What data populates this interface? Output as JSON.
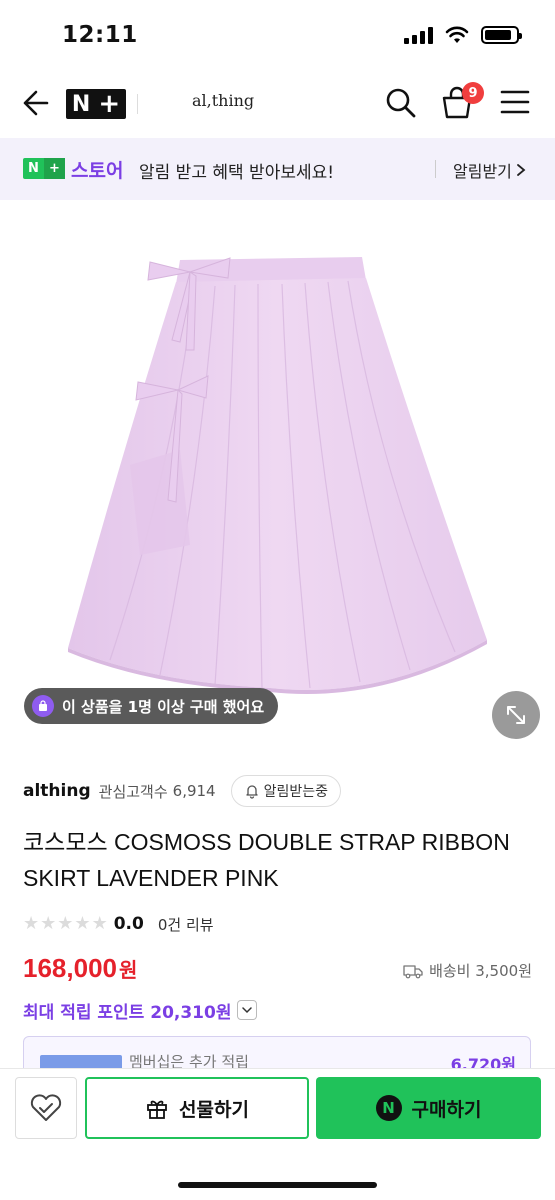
{
  "status_bar": {
    "time": "12:11",
    "battery_level": 0.85
  },
  "header": {
    "logo_text": "N",
    "logo_plus": "+",
    "store_name": "al,thing",
    "cart_badge": "9",
    "icons": [
      "back-arrow-icon",
      "search-icon",
      "cart-icon",
      "menu-icon"
    ]
  },
  "promo": {
    "logo_left": "N",
    "logo_right": "+",
    "store_label": "스토어",
    "message": "알림 받고 혜택 받아보세요!",
    "cta": "알림받기",
    "cta_icon": "chevron-right-icon"
  },
  "product": {
    "image_alt": "lavender wrap skirt",
    "buyer_badge": "이 상품을 1명 이상 구매 했어요",
    "brand": "althing",
    "follower_label": "관심고객수",
    "follower_count": "6,914",
    "alarm_chip": "알림받는중",
    "title": "코스모스 COSMOSS DOUBLE STRAP RIBBON SKIRT LAVENDER PINK",
    "rating_stars": 5,
    "rating_value": 0,
    "rating_score": "0.0",
    "review_count": "0건 리뷰",
    "price": "168,000",
    "price_unit": "원",
    "shipping": "배송비 3,500원",
    "points": "최대 적립 포인트 20,310원",
    "membership_text": "멤버십은 추가 적립",
    "membership_amount": "6,720원"
  },
  "bottom_bar": {
    "gift_label": "선물하기",
    "buy_label": "구매하기",
    "buy_logo": "N"
  },
  "colors": {
    "accent_green": "#20c25a",
    "accent_purple": "#7b3fe4",
    "price_red": "#e5212b",
    "skirt": "#ecd3f0"
  }
}
